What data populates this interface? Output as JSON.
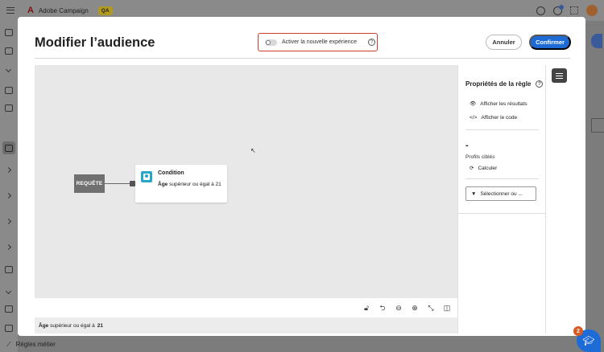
{
  "app": {
    "name": "Adobe Campaign",
    "env_badge": "QA",
    "bottom_nav_label": "Règles métier"
  },
  "notifications": {
    "help_badge_count": "2"
  },
  "modal": {
    "title": "Modifier l’audience",
    "toggle_label": "Activer la nouvelle expérience",
    "toggle_on": false,
    "cancel_label": "Annuler",
    "confirm_label": "Confirmer"
  },
  "canvas": {
    "query_node_label": "REQUÊTE",
    "condition": {
      "title": "Condition",
      "desc_bold": "Âge",
      "desc_rest": "supérieur ou égal à 21"
    },
    "toolbar_icons": [
      "lock-icon",
      "redo-icon",
      "zoom-out-icon",
      "zoom-in-icon",
      "fit-icon",
      "panel-icon"
    ]
  },
  "summary": {
    "field": "Âge",
    "operator": "supérieur ou égal à",
    "value": "21"
  },
  "properties": {
    "title": "Propriétés de la règle",
    "show_results": "Afficher les résultats",
    "show_code": "Afficher le code",
    "count_value": "-",
    "profiles_label": "Profils ciblés",
    "calculate": "Calculer",
    "select_button": "Sélectionner ou ..."
  },
  "colors": {
    "accent": "#1e6bd6",
    "highlight_border": "#d33b2c",
    "condition_icon": "#27a6c9"
  }
}
